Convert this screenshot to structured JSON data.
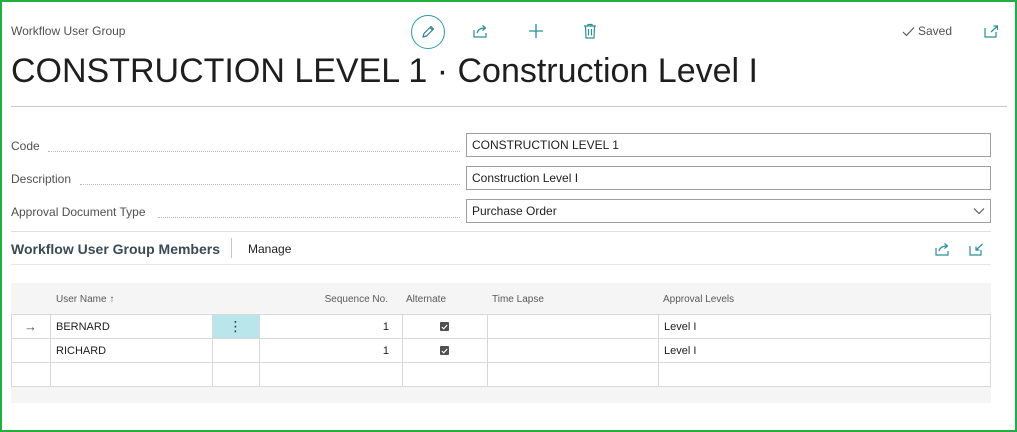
{
  "page": {
    "caption": "Workflow User Group",
    "title": "CONSTRUCTION LEVEL 1 · Construction Level I",
    "status": "Saved"
  },
  "toolbar": {
    "edit_icon": "pencil-icon",
    "share_icon": "share-icon",
    "new_icon": "plus-icon",
    "delete_icon": "trash-icon",
    "popout_icon": "open-new-window-icon"
  },
  "fields": {
    "code": {
      "label": "Code",
      "value": "CONSTRUCTION LEVEL 1"
    },
    "description": {
      "label": "Description",
      "value": "Construction Level I"
    },
    "approval_document_type": {
      "label": "Approval Document Type",
      "value": "Purchase Order"
    }
  },
  "subpage": {
    "title": "Workflow User Group Members",
    "manage_label": "Manage",
    "columns": {
      "user_name": "User Name",
      "sort_indicator": "↑",
      "sequence_no": "Sequence No.",
      "alternate": "Alternate",
      "time_lapse": "Time Lapse",
      "approval_levels": "Approval Levels"
    },
    "rows": [
      {
        "user_name": "BERNARD",
        "sequence_no": "1",
        "alternate": true,
        "time_lapse": "",
        "approval_levels": "Level I"
      },
      {
        "user_name": "RICHARD",
        "sequence_no": "1",
        "alternate": true,
        "time_lapse": "",
        "approval_levels": "Level I"
      }
    ],
    "row_menu_glyph": "⋮",
    "current_row_glyph": "→"
  },
  "colors": {
    "frame": "#1fb040",
    "accent": "#2a9aa6",
    "selected_cell": "#b8e6ea"
  }
}
